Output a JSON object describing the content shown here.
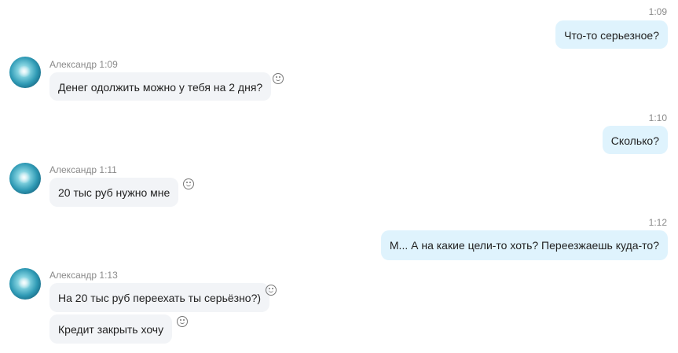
{
  "messages_out": [
    {
      "time": "1:09",
      "text": "Что-то серьезное?"
    },
    {
      "time": "1:10",
      "text": "Сколько?"
    },
    {
      "time": "1:12",
      "text": "М... А на какие цели-то хоть? Переезжаешь куда-то?"
    }
  ],
  "messages_in": [
    {
      "sender": "Александр",
      "time": "1:09",
      "texts": [
        "Денег одолжить можно у тебя на 2 дня?"
      ]
    },
    {
      "sender": "Александр",
      "time": "1:11",
      "texts": [
        "20 тыс руб нужно мне"
      ]
    },
    {
      "sender": "Александр",
      "time": "1:13",
      "texts": [
        "На 20 тыс руб переехать ты серьёзно?)",
        "Кредит закрыть хочу"
      ]
    }
  ],
  "icons": {
    "avatar": "user-avatar",
    "reaction": "smiley-icon"
  }
}
